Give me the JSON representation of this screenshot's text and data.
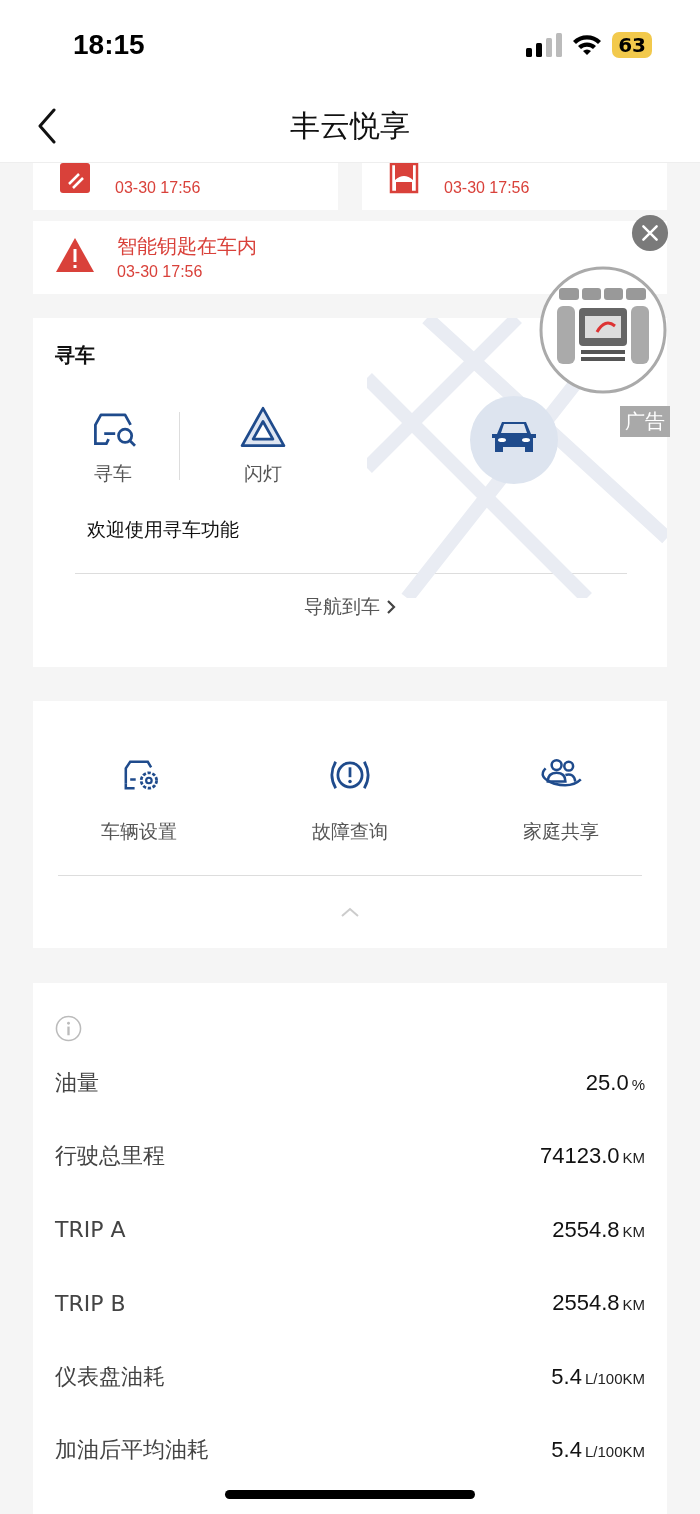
{
  "status_bar": {
    "time": "18:15",
    "battery": "63"
  },
  "header": {
    "title": "丰云悦享"
  },
  "alerts": [
    {
      "kind": "parking",
      "time": "03-30 17:56"
    },
    {
      "kind": "seat",
      "time": "03-30 17:56"
    },
    {
      "kind": "warning",
      "title": "智能钥匙在车内",
      "time": "03-30 17:56"
    }
  ],
  "ad": {
    "badge": "广告"
  },
  "find_car": {
    "title": "寻车",
    "actions": [
      {
        "kind": "search",
        "label": "寻车"
      },
      {
        "kind": "flash",
        "label": "闪灯"
      }
    ],
    "message": "欢迎使用寻车功能",
    "link": "导航到车"
  },
  "functions": [
    {
      "kind": "settings",
      "label": "车辆设置"
    },
    {
      "kind": "fault",
      "label": "故障查询"
    },
    {
      "kind": "share",
      "label": "家庭共享"
    }
  ],
  "stats": [
    {
      "label": "油量",
      "value": "25.0",
      "unit": "%"
    },
    {
      "label": "行驶总里程",
      "value": "74123.0",
      "unit": "KM"
    },
    {
      "label": "TRIP A",
      "value": "2554.8",
      "unit": "KM"
    },
    {
      "label": "TRIP B",
      "value": "2554.8",
      "unit": "KM"
    },
    {
      "label": "仪表盘油耗",
      "value": "5.4",
      "unit": "L/100KM"
    },
    {
      "label": "加油后平均油耗",
      "value": "5.4",
      "unit": "L/100KM"
    }
  ]
}
